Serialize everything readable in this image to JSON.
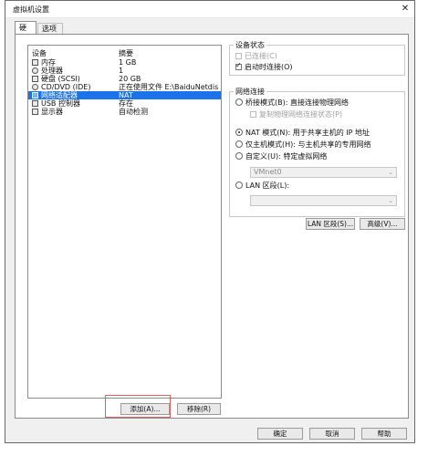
{
  "window": {
    "title": "虚拟机设置",
    "close_symbol": "✕"
  },
  "tabs": [
    {
      "label": "硬件"
    },
    {
      "label": "选项"
    }
  ],
  "device_list": {
    "headers": {
      "device": "设备",
      "summary": "摘要"
    },
    "rows": [
      {
        "device": "内存",
        "summary": "1 GB",
        "icon": "memory-icon"
      },
      {
        "device": "处理器",
        "summary": "1",
        "icon": "processor-icon"
      },
      {
        "device": "硬盘 (SCSI)",
        "summary": "20 GB",
        "icon": "hard-disk-icon"
      },
      {
        "device": "CD/DVD (IDE)",
        "summary": "正在使用文件 E:\\BaiduNetdiskD...",
        "icon": "cd-dvd-icon"
      },
      {
        "device": "网络适配器",
        "summary": "NAT",
        "icon": "network-adapter-icon",
        "selected": true
      },
      {
        "device": "USB 控制器",
        "summary": "存在",
        "icon": "usb-icon"
      },
      {
        "device": "显示器",
        "summary": "自动检测",
        "icon": "display-icon"
      }
    ]
  },
  "list_buttons": {
    "add": "添加(A)...",
    "remove": "移除(R)"
  },
  "device_status": {
    "legend": "设备状态",
    "connected": {
      "label": "已连接(C)",
      "checked": false,
      "disabled": true
    },
    "connect_on_power": {
      "label": "启动时连接(O)",
      "checked": true
    }
  },
  "network": {
    "legend": "网络连接",
    "bridged": {
      "label": "桥接模式(B): 直接连接物理网络",
      "selected": false
    },
    "replicate": {
      "label": "复制物理网络连接状态(P)",
      "checked": false
    },
    "nat": {
      "label": "NAT 模式(N): 用于共享主机的 IP 地址",
      "selected": true
    },
    "host_only": {
      "label": "仅主机模式(H): 与主机共享的专用网络",
      "selected": false
    },
    "custom": {
      "label": "自定义(U): 特定虚拟网络",
      "selected": false
    },
    "custom_select": "VMnet0",
    "lan": {
      "label": "LAN 区段(L):",
      "selected": false
    },
    "lan_select": "",
    "lan_segment_button": "LAN 区段(S)...",
    "advanced_button": "高级(V)..."
  },
  "footer": {
    "ok": "确定",
    "cancel": "取消",
    "help": "帮助"
  }
}
